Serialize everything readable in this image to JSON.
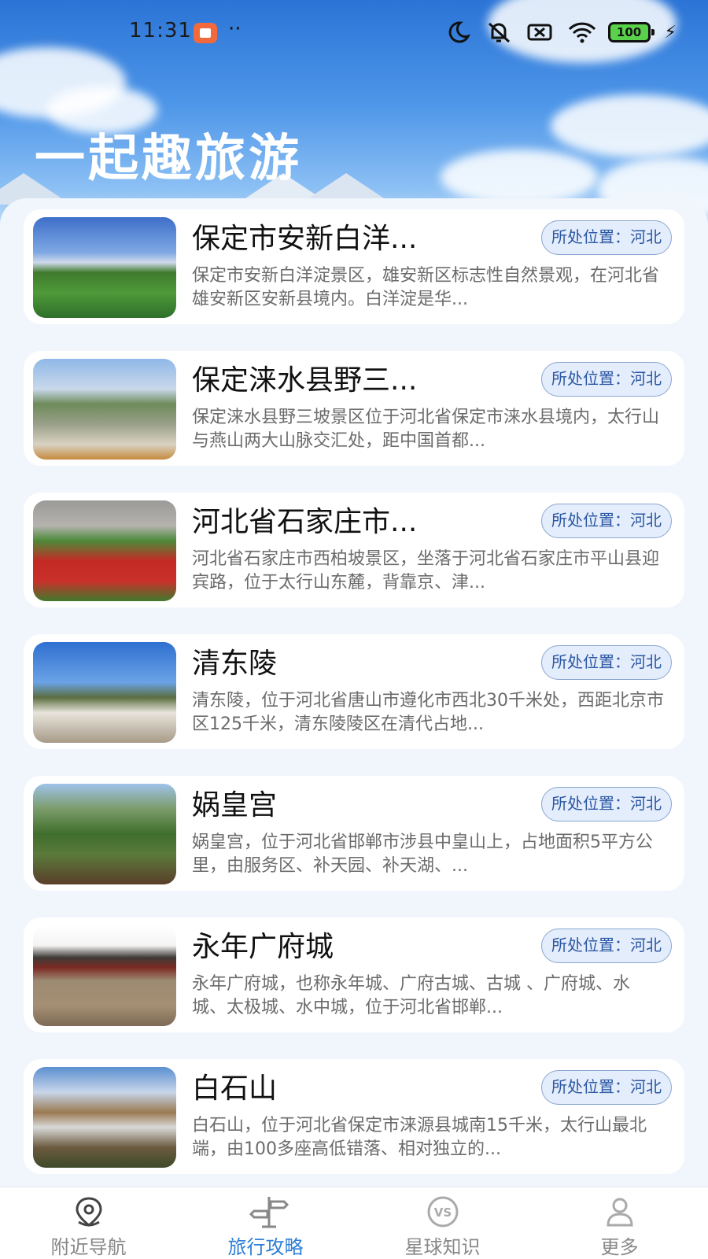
{
  "status_bar": {
    "time": "11:31",
    "dots": "··",
    "battery": "100"
  },
  "header": {
    "title": "一起趣旅游"
  },
  "spots": [
    {
      "title": "保定市安新白洋...",
      "badge": "所处位置：河北",
      "desc": "保定市安新白洋淀景区，雄安新区标志性自然景观，在河北省雄安新区安新县境内。白洋淀是华..."
    },
    {
      "title": "保定涞水县野三...",
      "badge": "所处位置：河北",
      "desc": "保定涞水县野三坡景区位于河北省保定市涞水县境内，太行山与燕山两大山脉交汇处，距中国首都..."
    },
    {
      "title": "河北省石家庄市...",
      "badge": "所处位置：河北",
      "desc": "河北省石家庄市西柏坡景区，坐落于河北省石家庄市平山县迎宾路，位于太行山东麓，背靠京、津..."
    },
    {
      "title": "清东陵",
      "badge": "所处位置：河北",
      "desc": "清东陵，位于河北省唐山市遵化市西北30千米处，西距北京市区125千米，清东陵陵区在清代占地..."
    },
    {
      "title": "娲皇宫",
      "badge": "所处位置：河北",
      "desc": "娲皇宫，位于河北省邯郸市涉县中皇山上，占地面积5平方公里，由服务区、补天园、补天湖、..."
    },
    {
      "title": "永年广府城",
      "badge": "所处位置：河北",
      "desc": "永年广府城，也称永年城、广府古城、古城 、广府城、水城、太极城、水中城，位于河北省邯郸..."
    },
    {
      "title": "白石山",
      "badge": "所处位置：河北",
      "desc": "白石山，位于河北省保定市涞源县城南15千米，太行山最北端，由100多座高低错落、相对独立的..."
    }
  ],
  "tabbar": {
    "items": [
      {
        "label": "附近导航",
        "icon": "map-pin-icon",
        "active": false
      },
      {
        "label": "旅行攻略",
        "icon": "signpost-icon",
        "active": true
      },
      {
        "label": "星球知识",
        "icon": "vs-icon",
        "active": false
      },
      {
        "label": "更多",
        "icon": "user-icon",
        "active": false
      }
    ]
  },
  "colors": {
    "accent": "#2e7fd6",
    "badge_bg": "#e4edfb",
    "badge_text": "#2b57a3"
  }
}
